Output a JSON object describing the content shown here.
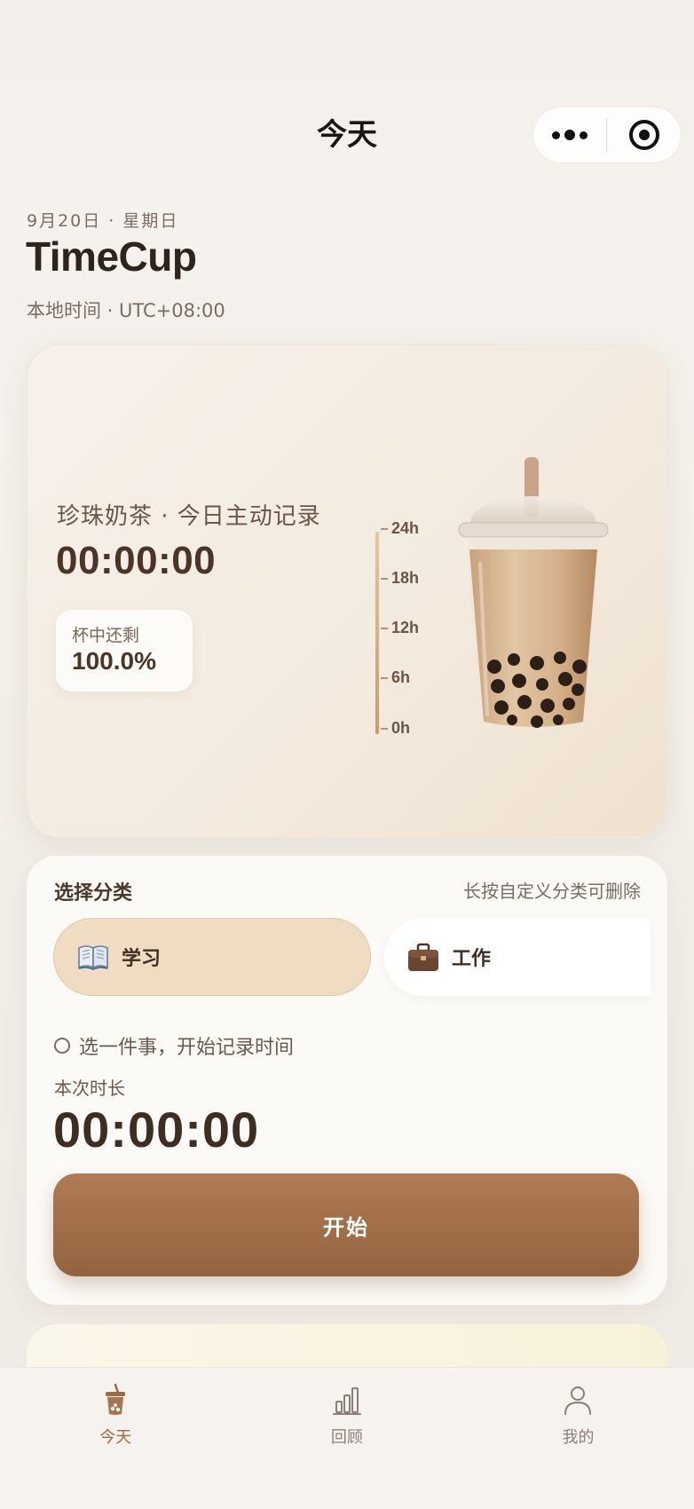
{
  "nav": {
    "title": "今天",
    "more_icon": "more-dots-icon",
    "target_icon": "target-icon"
  },
  "header": {
    "date": "9月20日 · 星期日",
    "brand": "TimeCup",
    "timezone": "本地时间 · UTC+08:00"
  },
  "cup": {
    "title": "珍珠奶茶 · 今日主动记录",
    "time": "00:00:00",
    "remain_label": "杯中还剩",
    "remain_value": "100.0%",
    "remain_fraction": 1.0,
    "scale": [
      "24h",
      "18h",
      "12h",
      "6h",
      "0h"
    ]
  },
  "category": {
    "title": "选择分类",
    "hint": "长按自定义分类可删除",
    "items": [
      {
        "label": "学习",
        "icon": "book-icon",
        "selected": true
      },
      {
        "label": "工作",
        "icon": "briefcase-icon",
        "selected": false
      }
    ],
    "prompt": "选一件事，开始记录时间",
    "duration_label": "本次时长",
    "duration_value": "00:00:00",
    "start_label": "开始"
  },
  "tabs": [
    {
      "label": "今天",
      "icon": "cup-icon",
      "active": true
    },
    {
      "label": "回顾",
      "icon": "bar-chart-icon",
      "active": false
    },
    {
      "label": "我的",
      "icon": "person-icon",
      "active": false
    }
  ],
  "colors": {
    "accent": "#a2704a",
    "card_bg": "#f5ede3",
    "pill_active": "#efdcc2"
  }
}
